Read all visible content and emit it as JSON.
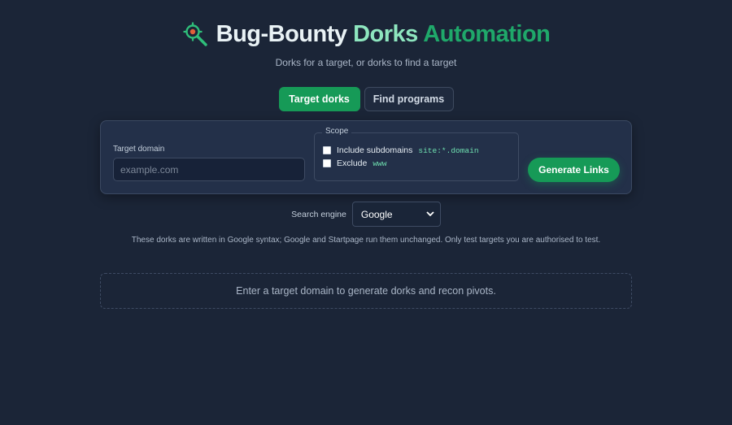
{
  "header": {
    "title_part1": "Bug-Bounty ",
    "title_part2": "Dorks ",
    "title_part3": "Automation",
    "logo_icon": "crosshair-magnifier-icon",
    "subtitle": "Dorks for a target, or dorks to find a target"
  },
  "tabs": [
    {
      "label": "Target dorks",
      "active": true
    },
    {
      "label": "Find programs",
      "active": false
    }
  ],
  "form": {
    "domain_label": "Target domain",
    "domain_placeholder": "example.com",
    "domain_value": "",
    "scope_legend": "Scope",
    "include_subdomains_label": "Include subdomains",
    "include_subdomains_code": "site:*.domain",
    "include_subdomains_checked": false,
    "exclude_label": "Exclude",
    "exclude_code": "www",
    "exclude_checked": false,
    "generate_label": "Generate Links"
  },
  "engine": {
    "label": "Search engine",
    "selected": "Google"
  },
  "note": "These dorks are written in Google syntax; Google and Startpage run them unchanged. Only test targets you are authorised to test.",
  "empty_state": "Enter a target domain to generate dorks and recon pivots.",
  "colors": {
    "background": "#1b2537",
    "accent": "#169a57",
    "title_light": "#e9f2f5",
    "title_mint": "#8ee6bf",
    "title_green": "#1fa86a",
    "code": "#6fe0b0"
  }
}
